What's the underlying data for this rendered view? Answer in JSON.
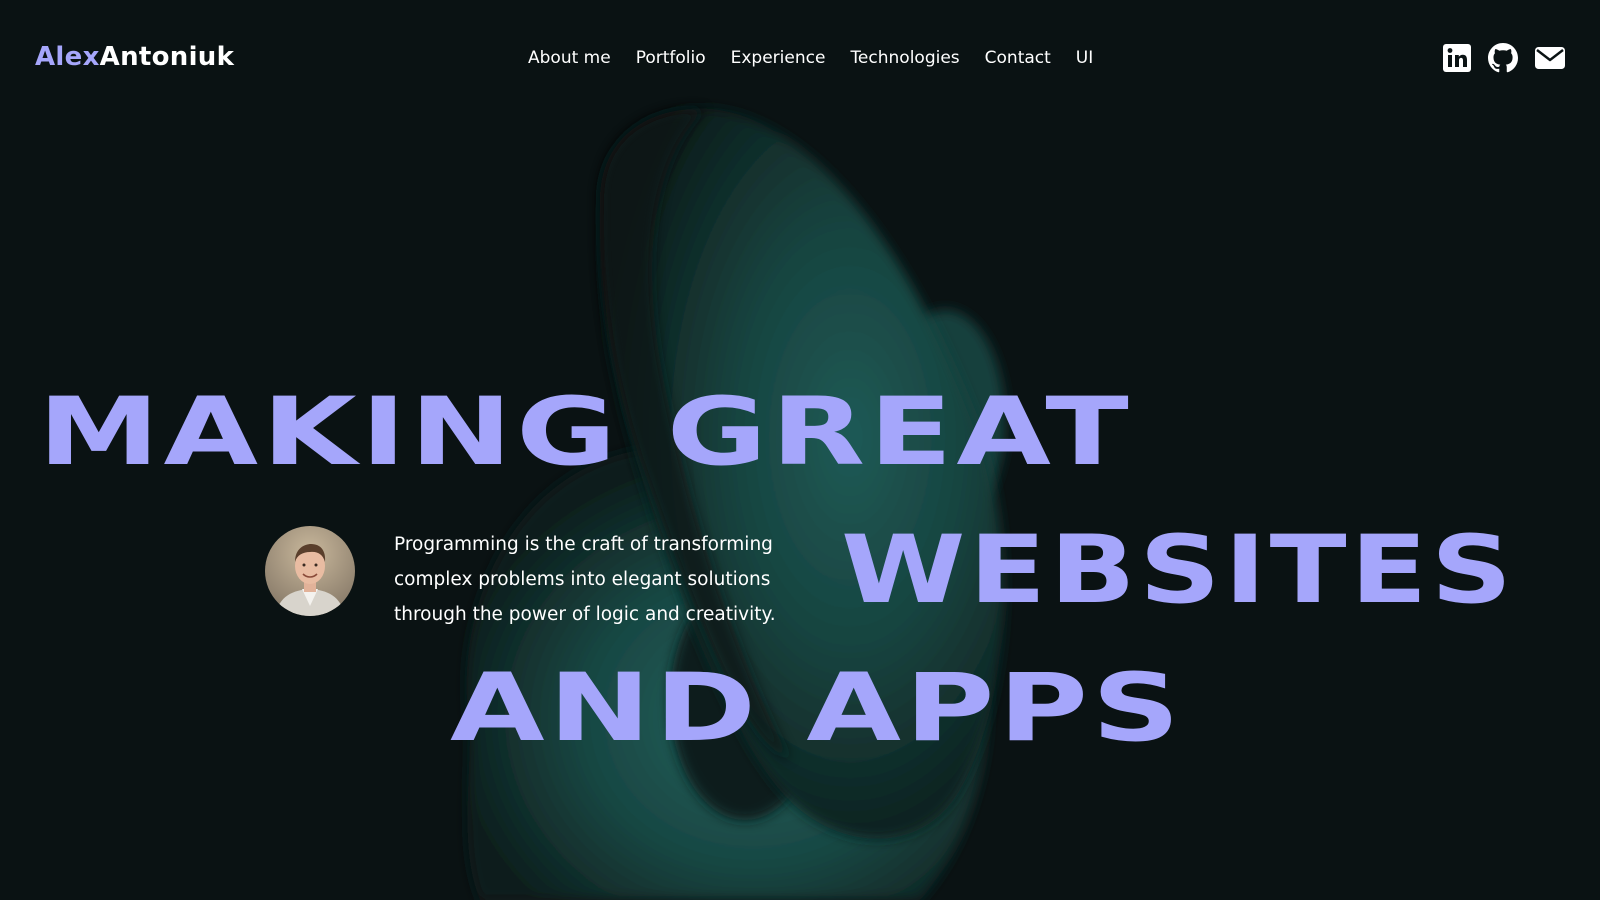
{
  "brand": {
    "first": "Alex",
    "last": "Antoniuk",
    "accent_color": "#a6a6fb"
  },
  "nav": {
    "items": [
      {
        "label": "About me"
      },
      {
        "label": "Portfolio"
      },
      {
        "label": "Experience"
      },
      {
        "label": "Technologies"
      },
      {
        "label": "Contact"
      },
      {
        "label": "UI"
      }
    ]
  },
  "socials": [
    {
      "icon": "linkedin-icon"
    },
    {
      "icon": "github-icon"
    },
    {
      "icon": "mail-icon"
    }
  ],
  "hero": {
    "headline": [
      "MAKING GREAT",
      "WEBSITES",
      "AND APPS"
    ],
    "tagline": [
      "Programming is the craft of transforming",
      "complex problems into elegant solutions",
      "through the power of logic and creativity."
    ],
    "headline_color": "#a5a6fb",
    "background_color": "#0a1213",
    "blob_color": "#1f5350"
  }
}
